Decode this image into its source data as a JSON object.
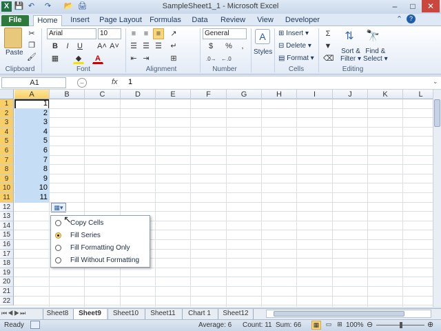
{
  "title": "SampleSheet1_1 - Microsoft Excel",
  "quick_access": {
    "save": "💾",
    "undo": "↶",
    "redo": "↷",
    "open": "📂",
    "print": "🖨"
  },
  "window_buttons": {
    "minimize": "–",
    "maximize": "□",
    "close": "✕"
  },
  "tabs": [
    "File",
    "Home",
    "Insert",
    "Page Layout",
    "Formulas",
    "Data",
    "Review",
    "View",
    "Developer"
  ],
  "ribbon": {
    "clipboard": {
      "label": "Clipboard",
      "paste": "Paste"
    },
    "font": {
      "label": "Font",
      "name": "Arial",
      "size": "10",
      "bold": "B",
      "italic": "I",
      "underline": "U",
      "grow": "A˄",
      "shrink": "A˅"
    },
    "alignment": {
      "label": "Alignment"
    },
    "number": {
      "label": "Number",
      "format": "General",
      "dollar": "$",
      "percent": "%",
      "comma": ","
    },
    "styles": {
      "label": "Styles"
    },
    "cells": {
      "label": "Cells",
      "insert": "Insert",
      "delete": "Delete",
      "format": "Format"
    },
    "editing": {
      "label": "Editing",
      "sort": "Sort &",
      "filter": "Filter",
      "find": "Find &",
      "select": "Select"
    }
  },
  "formula_bar": {
    "name_box": "A1",
    "fx": "fx",
    "value": "1"
  },
  "columns": [
    "A",
    "B",
    "C",
    "D",
    "E",
    "F",
    "G",
    "H",
    "I",
    "J",
    "K",
    "L"
  ],
  "rows": [
    "1",
    "2",
    "3",
    "4",
    "5",
    "6",
    "7",
    "8",
    "9",
    "10",
    "11",
    "12",
    "13",
    "14",
    "15",
    "16",
    "17",
    "18",
    "19",
    "20",
    "21",
    "22"
  ],
  "column_a_values": [
    "1",
    "2",
    "3",
    "4",
    "5",
    "6",
    "7",
    "8",
    "9",
    "10",
    "11"
  ],
  "autofill_menu": {
    "options": [
      "Copy Cells",
      "Fill Series",
      "Fill Formatting Only",
      "Fill Without Formatting"
    ],
    "selected": "Fill Series"
  },
  "sheet_tabs": [
    "Sheet8",
    "Sheet9",
    "Sheet10",
    "Sheet11",
    "Chart 1",
    "Sheet12"
  ],
  "active_sheet": "Sheet9",
  "status": {
    "mode": "Ready",
    "average": "Average: 6",
    "count": "Count: 11",
    "sum": "Sum: 66",
    "zoom": "100%"
  }
}
